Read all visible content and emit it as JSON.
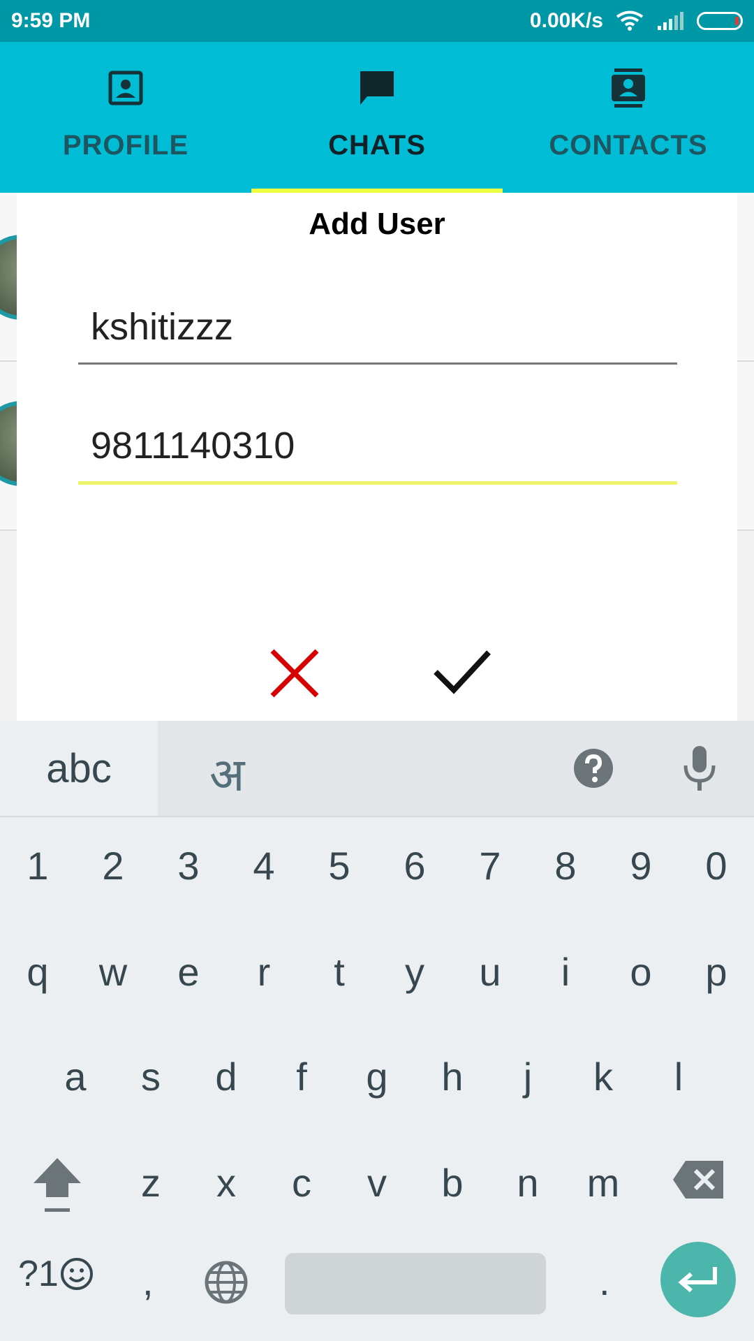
{
  "status_bar": {
    "time": "9:59 PM",
    "net_speed": "0.00K/s"
  },
  "tabs": [
    {
      "label": "PROFILE",
      "icon": "profile-icon",
      "active": false
    },
    {
      "label": "CHATS",
      "icon": "chat-icon",
      "active": true
    },
    {
      "label": "CONTACTS",
      "icon": "contacts-icon",
      "active": false
    }
  ],
  "dialog": {
    "title": "Add User",
    "name_value": "kshitizzz",
    "phone_value": "9811140310",
    "cancel_icon": "close-icon",
    "confirm_icon": "check-icon"
  },
  "keyboard": {
    "mode_abc": "abc",
    "mode_hindi": "अ",
    "row_numbers": [
      "1",
      "2",
      "3",
      "4",
      "5",
      "6",
      "7",
      "8",
      "9",
      "0"
    ],
    "row_q": [
      "q",
      "w",
      "e",
      "r",
      "t",
      "y",
      "u",
      "i",
      "o",
      "p"
    ],
    "row_a": [
      "a",
      "s",
      "d",
      "f",
      "g",
      "h",
      "j",
      "k",
      "l"
    ],
    "row_z": [
      "z",
      "x",
      "c",
      "v",
      "b",
      "n",
      "m"
    ],
    "symbols_label": "?1",
    "comma": ",",
    "period": "."
  },
  "colors": {
    "status_bar": "#0097A7",
    "tab_bar": "#00BCD4",
    "tab_indicator": "#EEFF41",
    "cancel": "#D50000",
    "enter": "#4DB6AC"
  }
}
